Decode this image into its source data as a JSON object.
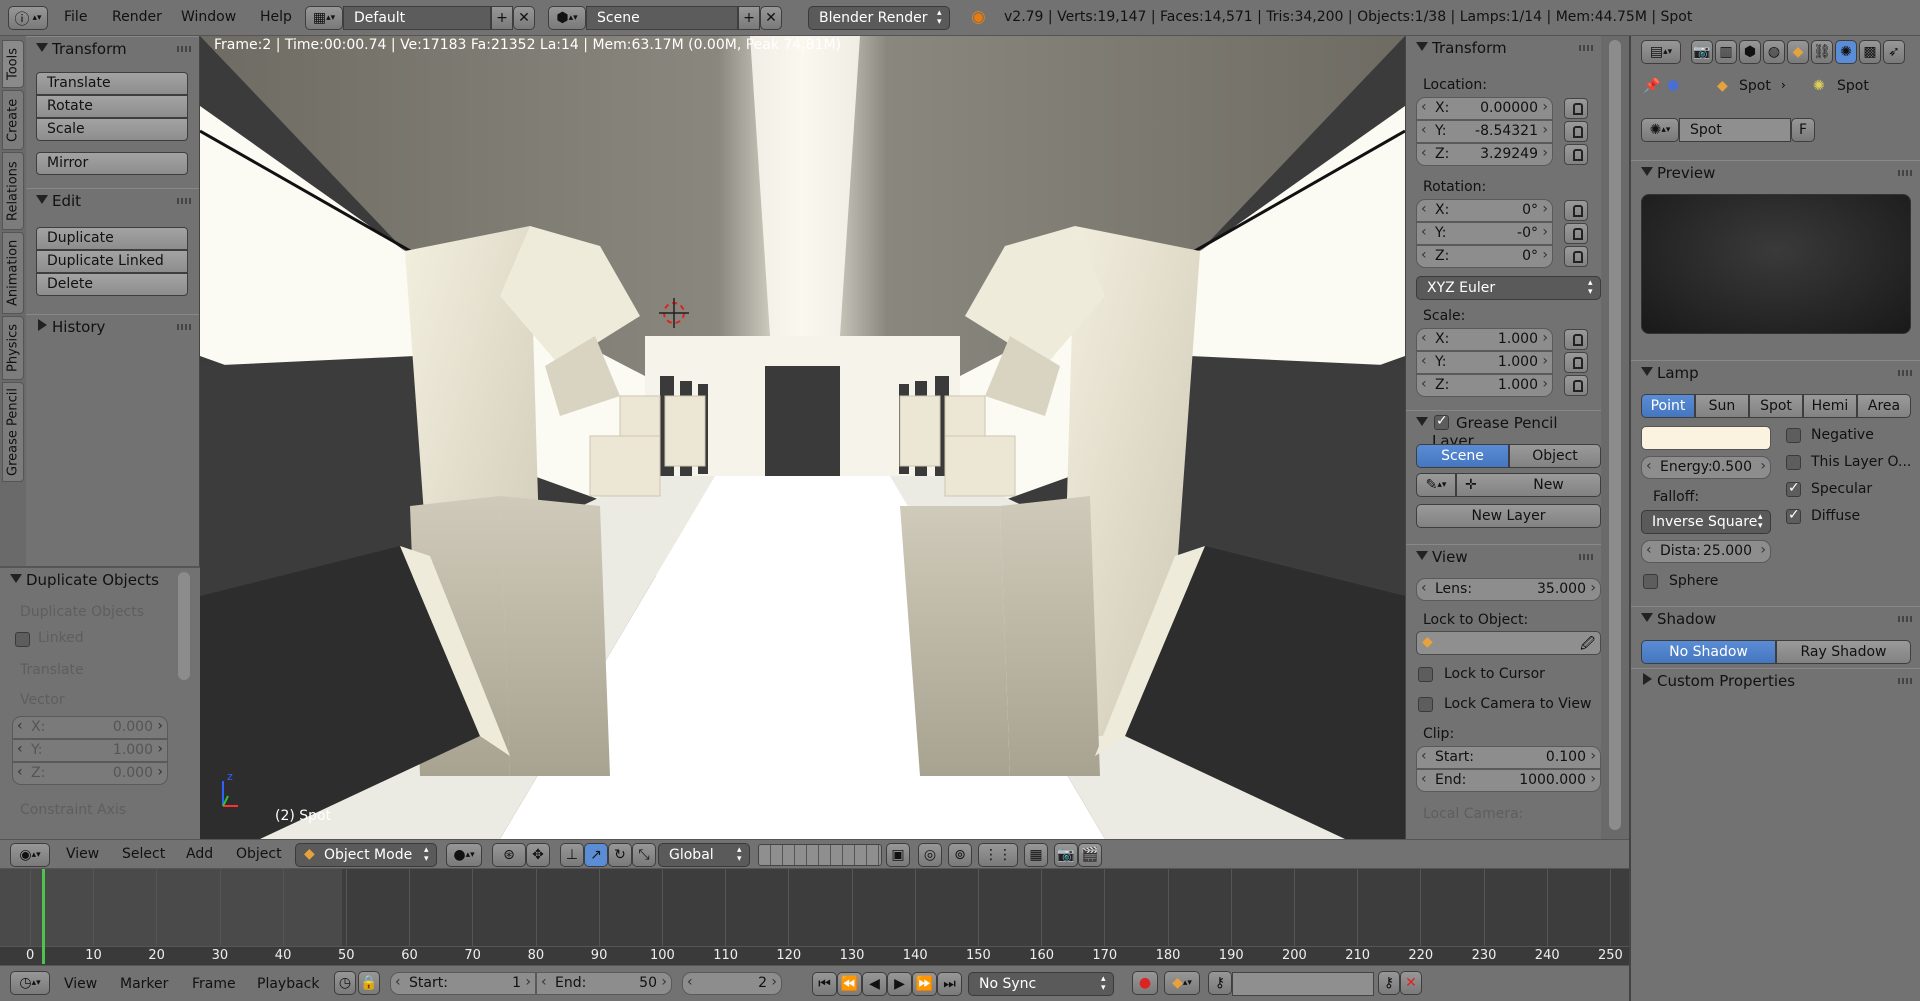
{
  "header": {
    "menus": [
      "File",
      "Render",
      "Window",
      "Help"
    ],
    "layout": "Default",
    "scene": "Scene",
    "engine": "Blender Render",
    "stats": "v2.79 | Verts:19,147 | Faces:14,571 | Tris:34,200 | Objects:1/38 | Lamps:1/14 | Mem:44.75M | Spot"
  },
  "left_tabs": [
    "Tools",
    "Create",
    "Relations",
    "Animation",
    "Physics",
    "Grease Pencil"
  ],
  "tools": {
    "transform_title": "Transform",
    "translate": "Translate",
    "rotate": "Rotate",
    "scale": "Scale",
    "mirror": "Mirror",
    "edit_title": "Edit",
    "duplicate": "Duplicate",
    "duplicate_linked": "Duplicate Linked",
    "delete": "Delete",
    "history_title": "History"
  },
  "operator": {
    "title": "Duplicate Objects",
    "subtitle": "Duplicate Objects",
    "linked": "Linked",
    "translate": "Translate",
    "vector": "Vector",
    "x_label": "X:",
    "x": "0.000",
    "y_label": "Y:",
    "y": "1.000",
    "z_label": "Z:",
    "z": "0.000",
    "constraint_axis": "Constraint Axis"
  },
  "viewport": {
    "info": "Frame:2 | Time:00:00.74 | Ve:17183 Fa:21352 La:14 | Mem:63.17M (0.00M, Peak 74.81M)",
    "object_label": "(2) Spot"
  },
  "npanel": {
    "transform_title": "Transform",
    "location_label": "Location:",
    "loc_x": "0.00000",
    "loc_y": "-8.54321",
    "loc_z": "3.29249",
    "rotation_label": "Rotation:",
    "rot_x": "0°",
    "rot_y": "-0°",
    "rot_z": "0°",
    "rotation_mode": "XYZ Euler",
    "scale_label": "Scale:",
    "scl_x": "1.000",
    "scl_y": "1.000",
    "scl_z": "1.000",
    "x": "X:",
    "y": "Y:",
    "z": "Z:",
    "gp_title": "Grease Pencil Layer",
    "gp_scene": "Scene",
    "gp_object": "Object",
    "gp_new": "New",
    "gp_new_layer": "New Layer",
    "view_title": "View",
    "lens_label": "Lens:",
    "lens": "35.000",
    "lock_object": "Lock to Object:",
    "lock_cursor": "Lock to Cursor",
    "lock_camera": "Lock Camera to View",
    "clip_label": "Clip:",
    "clip_start_label": "Start:",
    "clip_start": "0.100",
    "clip_end_label": "End:",
    "clip_end": "1000.000",
    "local_camera": "Local Camera:"
  },
  "properties": {
    "crumb_1": "Spot",
    "crumb_2": "Spot",
    "datablock": "Spot",
    "fake_user": "F",
    "preview_title": "Preview",
    "lamp_title": "Lamp",
    "lamp_types": [
      "Point",
      "Sun",
      "Spot",
      "Hemi",
      "Area"
    ],
    "lamp_type_active": "Point",
    "light_color": "#fbf3e0",
    "negative": "Negative",
    "this_layer": "This Layer O...",
    "specular": "Specular",
    "diffuse": "Diffuse",
    "energy_label": "Energy:",
    "energy": "0.500",
    "falloff_label": "Falloff:",
    "falloff": "Inverse Square",
    "distance_label": "Dista:",
    "distance": "25.000",
    "sphere": "Sphere",
    "shadow_title": "Shadow",
    "no_shadow": "No Shadow",
    "ray_shadow": "Ray Shadow",
    "custom_props": "Custom Properties"
  },
  "view3d_header": {
    "menus": [
      "View",
      "Select",
      "Add",
      "Object"
    ],
    "mode": "Object Mode",
    "orientation": "Global"
  },
  "timeline": {
    "ticks": [
      "0",
      "10",
      "20",
      "30",
      "40",
      "50",
      "60",
      "70",
      "80",
      "90",
      "100",
      "110",
      "120",
      "130",
      "140",
      "150",
      "160",
      "170",
      "180",
      "190",
      "200",
      "210",
      "220",
      "230",
      "240",
      "250"
    ],
    "current_frame": 2
  },
  "timeline_header": {
    "menus": [
      "View",
      "Marker",
      "Frame",
      "Playback"
    ],
    "start_label": "Start:",
    "start": "1",
    "end_label": "End:",
    "end": "50",
    "current": "2",
    "sync": "No Sync"
  }
}
